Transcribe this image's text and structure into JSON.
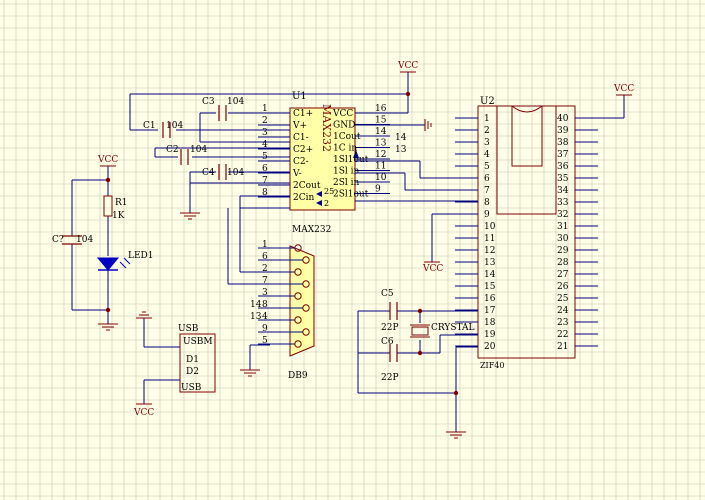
{
  "colors": {
    "background": "#ffffe8",
    "grid": "#c8c8b4",
    "wire": "#000080",
    "component": "#800000",
    "chip_fill": "#ffffa8",
    "label": "#000000",
    "junction": "#800000"
  },
  "power_labels": {
    "vcc": "VCC"
  },
  "u1": {
    "ref": "U1",
    "part": "MAX232",
    "left_pins": [
      {
        "num": "1",
        "name": "C1+"
      },
      {
        "num": "2",
        "name": "V+"
      },
      {
        "num": "3",
        "name": "C1-"
      },
      {
        "num": "4",
        "name": "C2+"
      },
      {
        "num": "5",
        "name": "C2-"
      },
      {
        "num": "6",
        "name": "V-"
      },
      {
        "num": "7",
        "name": "2Cout"
      },
      {
        "num": "8",
        "name": "2Cin"
      }
    ],
    "right_pins": [
      {
        "num": "16",
        "name": "VCC"
      },
      {
        "num": "15",
        "name": "GND"
      },
      {
        "num": "14",
        "name": "1Cout"
      },
      {
        "num": "13",
        "name": "1C in"
      },
      {
        "num": "12",
        "name": "1Sl1out"
      },
      {
        "num": "11",
        "name": "1Sl in"
      },
      {
        "num": "10",
        "name": "2Sl in"
      },
      {
        "num": "9",
        "name": "2Sl1out"
      }
    ],
    "inner_marks": {
      "p7": "25",
      "p8": "2"
    },
    "net_labels": {
      "n14": "14",
      "n13": "13"
    }
  },
  "capacitors": {
    "c1": {
      "ref": "C1",
      "value": "104"
    },
    "c2": {
      "ref": "C2",
      "value": "104"
    },
    "c3": {
      "ref": "C3",
      "value": "104"
    },
    "c4": {
      "ref": "C4",
      "value": "104"
    },
    "c7": {
      "ref": "C?",
      "value": "104"
    },
    "c5": {
      "ref": "C5",
      "value": "22P"
    },
    "c6": {
      "ref": "C6",
      "value": "22P"
    }
  },
  "led": {
    "r_ref": "R1",
    "r_value": "1K",
    "led_ref": "LED1"
  },
  "db9": {
    "label_top": "MAX232",
    "label_bottom": "DB9",
    "pins": [
      "1",
      "6",
      "2",
      "7",
      "3",
      "8",
      "4",
      "9",
      "5"
    ],
    "net_labels": [
      {
        "pin": "8",
        "net": "14"
      },
      {
        "pin": "4",
        "net": "13"
      }
    ]
  },
  "usb": {
    "ref": "USB",
    "part": "USBM",
    "pins": [
      "D1",
      "D2"
    ],
    "bottom": "USB"
  },
  "crystal": {
    "label": "CRYSTAL"
  },
  "u2": {
    "ref": "U2",
    "part": "ZIF40",
    "left_pins": [
      "1",
      "2",
      "3",
      "4",
      "5",
      "6",
      "7",
      "8",
      "9",
      "10",
      "11",
      "12",
      "13",
      "14",
      "15",
      "16",
      "17",
      "18",
      "19",
      "20"
    ],
    "right_pins": [
      "40",
      "39",
      "38",
      "37",
      "36",
      "35",
      "34",
      "33",
      "32",
      "31",
      "30",
      "29",
      "28",
      "27",
      "26",
      "25",
      "24",
      "23",
      "22",
      "21"
    ]
  }
}
